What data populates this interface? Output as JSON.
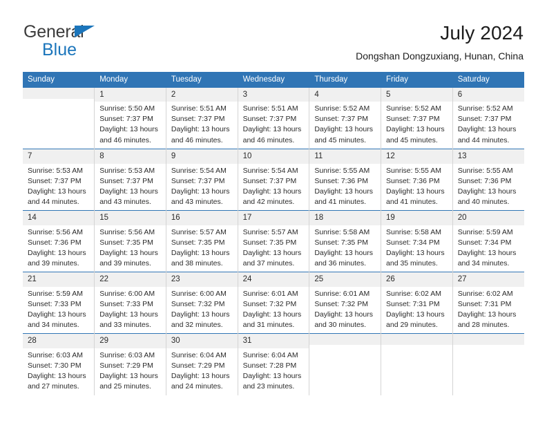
{
  "brand": {
    "line1": "General",
    "line2": "Blue",
    "accent_color": "#1b75bb"
  },
  "header": {
    "title": "July 2024",
    "subtitle": "Dongshan Dongzuxiang, Hunan, China"
  },
  "colors": {
    "header_blue": "#3075b5",
    "daynum_band": "#f0f0f0",
    "cell_border": "#d4d4d4",
    "text": "#2a2a2a"
  },
  "weekday_headers": [
    "Sunday",
    "Monday",
    "Tuesday",
    "Wednesday",
    "Thursday",
    "Friday",
    "Saturday"
  ],
  "weeks": [
    [
      {
        "day": "",
        "empty": true,
        "sunrise": "",
        "sunset": "",
        "daylight_line1": "",
        "daylight_line2": ""
      },
      {
        "day": "1",
        "sunrise": "Sunrise: 5:50 AM",
        "sunset": "Sunset: 7:37 PM",
        "daylight_line1": "Daylight: 13 hours",
        "daylight_line2": "and 46 minutes."
      },
      {
        "day": "2",
        "sunrise": "Sunrise: 5:51 AM",
        "sunset": "Sunset: 7:37 PM",
        "daylight_line1": "Daylight: 13 hours",
        "daylight_line2": "and 46 minutes."
      },
      {
        "day": "3",
        "sunrise": "Sunrise: 5:51 AM",
        "sunset": "Sunset: 7:37 PM",
        "daylight_line1": "Daylight: 13 hours",
        "daylight_line2": "and 46 minutes."
      },
      {
        "day": "4",
        "sunrise": "Sunrise: 5:52 AM",
        "sunset": "Sunset: 7:37 PM",
        "daylight_line1": "Daylight: 13 hours",
        "daylight_line2": "and 45 minutes."
      },
      {
        "day": "5",
        "sunrise": "Sunrise: 5:52 AM",
        "sunset": "Sunset: 7:37 PM",
        "daylight_line1": "Daylight: 13 hours",
        "daylight_line2": "and 45 minutes."
      },
      {
        "day": "6",
        "sunrise": "Sunrise: 5:52 AM",
        "sunset": "Sunset: 7:37 PM",
        "daylight_line1": "Daylight: 13 hours",
        "daylight_line2": "and 44 minutes."
      }
    ],
    [
      {
        "day": "7",
        "sunrise": "Sunrise: 5:53 AM",
        "sunset": "Sunset: 7:37 PM",
        "daylight_line1": "Daylight: 13 hours",
        "daylight_line2": "and 44 minutes."
      },
      {
        "day": "8",
        "sunrise": "Sunrise: 5:53 AM",
        "sunset": "Sunset: 7:37 PM",
        "daylight_line1": "Daylight: 13 hours",
        "daylight_line2": "and 43 minutes."
      },
      {
        "day": "9",
        "sunrise": "Sunrise: 5:54 AM",
        "sunset": "Sunset: 7:37 PM",
        "daylight_line1": "Daylight: 13 hours",
        "daylight_line2": "and 43 minutes."
      },
      {
        "day": "10",
        "sunrise": "Sunrise: 5:54 AM",
        "sunset": "Sunset: 7:37 PM",
        "daylight_line1": "Daylight: 13 hours",
        "daylight_line2": "and 42 minutes."
      },
      {
        "day": "11",
        "sunrise": "Sunrise: 5:55 AM",
        "sunset": "Sunset: 7:36 PM",
        "daylight_line1": "Daylight: 13 hours",
        "daylight_line2": "and 41 minutes."
      },
      {
        "day": "12",
        "sunrise": "Sunrise: 5:55 AM",
        "sunset": "Sunset: 7:36 PM",
        "daylight_line1": "Daylight: 13 hours",
        "daylight_line2": "and 41 minutes."
      },
      {
        "day": "13",
        "sunrise": "Sunrise: 5:55 AM",
        "sunset": "Sunset: 7:36 PM",
        "daylight_line1": "Daylight: 13 hours",
        "daylight_line2": "and 40 minutes."
      }
    ],
    [
      {
        "day": "14",
        "sunrise": "Sunrise: 5:56 AM",
        "sunset": "Sunset: 7:36 PM",
        "daylight_line1": "Daylight: 13 hours",
        "daylight_line2": "and 39 minutes."
      },
      {
        "day": "15",
        "sunrise": "Sunrise: 5:56 AM",
        "sunset": "Sunset: 7:35 PM",
        "daylight_line1": "Daylight: 13 hours",
        "daylight_line2": "and 39 minutes."
      },
      {
        "day": "16",
        "sunrise": "Sunrise: 5:57 AM",
        "sunset": "Sunset: 7:35 PM",
        "daylight_line1": "Daylight: 13 hours",
        "daylight_line2": "and 38 minutes."
      },
      {
        "day": "17",
        "sunrise": "Sunrise: 5:57 AM",
        "sunset": "Sunset: 7:35 PM",
        "daylight_line1": "Daylight: 13 hours",
        "daylight_line2": "and 37 minutes."
      },
      {
        "day": "18",
        "sunrise": "Sunrise: 5:58 AM",
        "sunset": "Sunset: 7:35 PM",
        "daylight_line1": "Daylight: 13 hours",
        "daylight_line2": "and 36 minutes."
      },
      {
        "day": "19",
        "sunrise": "Sunrise: 5:58 AM",
        "sunset": "Sunset: 7:34 PM",
        "daylight_line1": "Daylight: 13 hours",
        "daylight_line2": "and 35 minutes."
      },
      {
        "day": "20",
        "sunrise": "Sunrise: 5:59 AM",
        "sunset": "Sunset: 7:34 PM",
        "daylight_line1": "Daylight: 13 hours",
        "daylight_line2": "and 34 minutes."
      }
    ],
    [
      {
        "day": "21",
        "sunrise": "Sunrise: 5:59 AM",
        "sunset": "Sunset: 7:33 PM",
        "daylight_line1": "Daylight: 13 hours",
        "daylight_line2": "and 34 minutes."
      },
      {
        "day": "22",
        "sunrise": "Sunrise: 6:00 AM",
        "sunset": "Sunset: 7:33 PM",
        "daylight_line1": "Daylight: 13 hours",
        "daylight_line2": "and 33 minutes."
      },
      {
        "day": "23",
        "sunrise": "Sunrise: 6:00 AM",
        "sunset": "Sunset: 7:32 PM",
        "daylight_line1": "Daylight: 13 hours",
        "daylight_line2": "and 32 minutes."
      },
      {
        "day": "24",
        "sunrise": "Sunrise: 6:01 AM",
        "sunset": "Sunset: 7:32 PM",
        "daylight_line1": "Daylight: 13 hours",
        "daylight_line2": "and 31 minutes."
      },
      {
        "day": "25",
        "sunrise": "Sunrise: 6:01 AM",
        "sunset": "Sunset: 7:32 PM",
        "daylight_line1": "Daylight: 13 hours",
        "daylight_line2": "and 30 minutes."
      },
      {
        "day": "26",
        "sunrise": "Sunrise: 6:02 AM",
        "sunset": "Sunset: 7:31 PM",
        "daylight_line1": "Daylight: 13 hours",
        "daylight_line2": "and 29 minutes."
      },
      {
        "day": "27",
        "sunrise": "Sunrise: 6:02 AM",
        "sunset": "Sunset: 7:31 PM",
        "daylight_line1": "Daylight: 13 hours",
        "daylight_line2": "and 28 minutes."
      }
    ],
    [
      {
        "day": "28",
        "sunrise": "Sunrise: 6:03 AM",
        "sunset": "Sunset: 7:30 PM",
        "daylight_line1": "Daylight: 13 hours",
        "daylight_line2": "and 27 minutes."
      },
      {
        "day": "29",
        "sunrise": "Sunrise: 6:03 AM",
        "sunset": "Sunset: 7:29 PM",
        "daylight_line1": "Daylight: 13 hours",
        "daylight_line2": "and 25 minutes."
      },
      {
        "day": "30",
        "sunrise": "Sunrise: 6:04 AM",
        "sunset": "Sunset: 7:29 PM",
        "daylight_line1": "Daylight: 13 hours",
        "daylight_line2": "and 24 minutes."
      },
      {
        "day": "31",
        "sunrise": "Sunrise: 6:04 AM",
        "sunset": "Sunset: 7:28 PM",
        "daylight_line1": "Daylight: 13 hours",
        "daylight_line2": "and 23 minutes."
      },
      {
        "day": "",
        "empty": true,
        "sunrise": "",
        "sunset": "",
        "daylight_line1": "",
        "daylight_line2": ""
      },
      {
        "day": "",
        "empty": true,
        "sunrise": "",
        "sunset": "",
        "daylight_line1": "",
        "daylight_line2": ""
      },
      {
        "day": "",
        "empty": true,
        "sunrise": "",
        "sunset": "",
        "daylight_line1": "",
        "daylight_line2": ""
      }
    ]
  ]
}
